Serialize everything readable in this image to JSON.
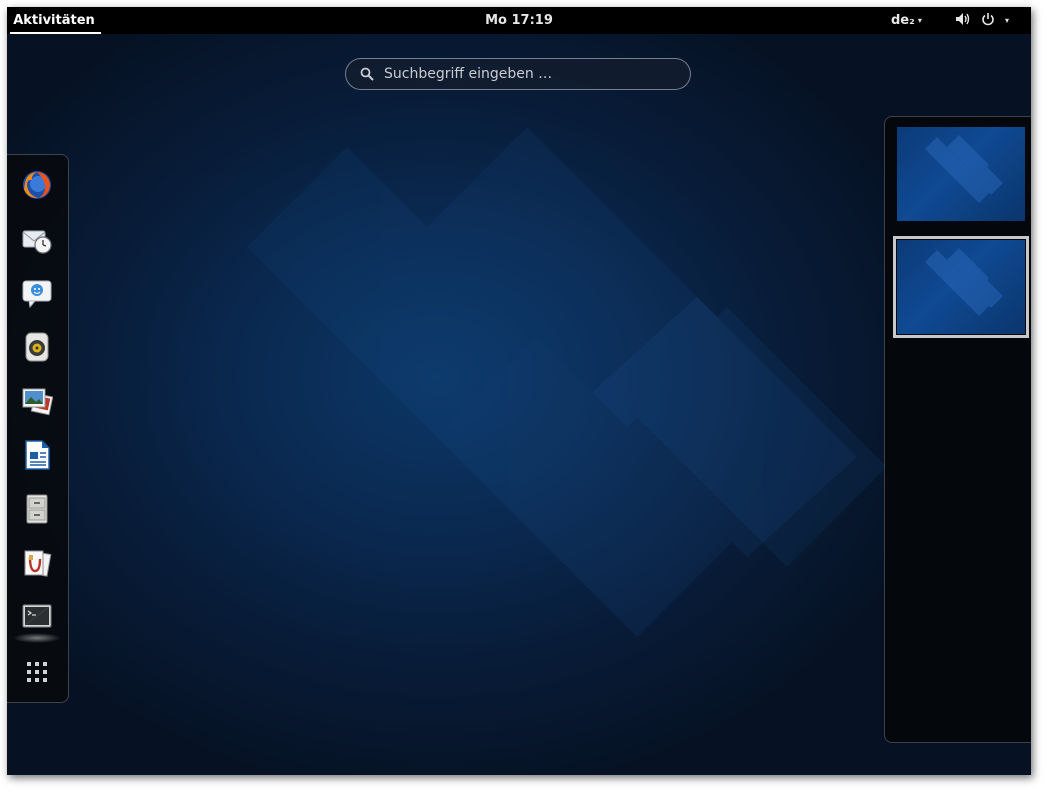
{
  "topbar": {
    "activities_label": "Aktivitäten",
    "clock": "Mo 17:19",
    "keyboard_layout": "de₂",
    "dropdown_arrow": "▾"
  },
  "search": {
    "placeholder": "Suchbegriff eingeben …"
  },
  "dash": {
    "items": [
      {
        "name": "firefox",
        "icon": "firefox-icon"
      },
      {
        "name": "evolution",
        "icon": "mail-clock-icon"
      },
      {
        "name": "empathy",
        "icon": "chat-bubble-icon"
      },
      {
        "name": "rhythmbox",
        "icon": "speaker-icon"
      },
      {
        "name": "shotwell",
        "icon": "photos-icon"
      },
      {
        "name": "libreoffice-writer",
        "icon": "document-writer-icon"
      },
      {
        "name": "files",
        "icon": "file-cabinet-icon"
      },
      {
        "name": "software",
        "icon": "package-icon"
      },
      {
        "name": "terminal",
        "icon": "terminal-icon",
        "running": true
      }
    ],
    "show_apps_icon": "grid-icon"
  },
  "workspaces": {
    "count": 2,
    "active_index": 1
  },
  "colors": {
    "topbar_bg": "#000000",
    "wallpaper_accent": "#0c3766",
    "workspace_highlight": "#c8c8c8"
  }
}
